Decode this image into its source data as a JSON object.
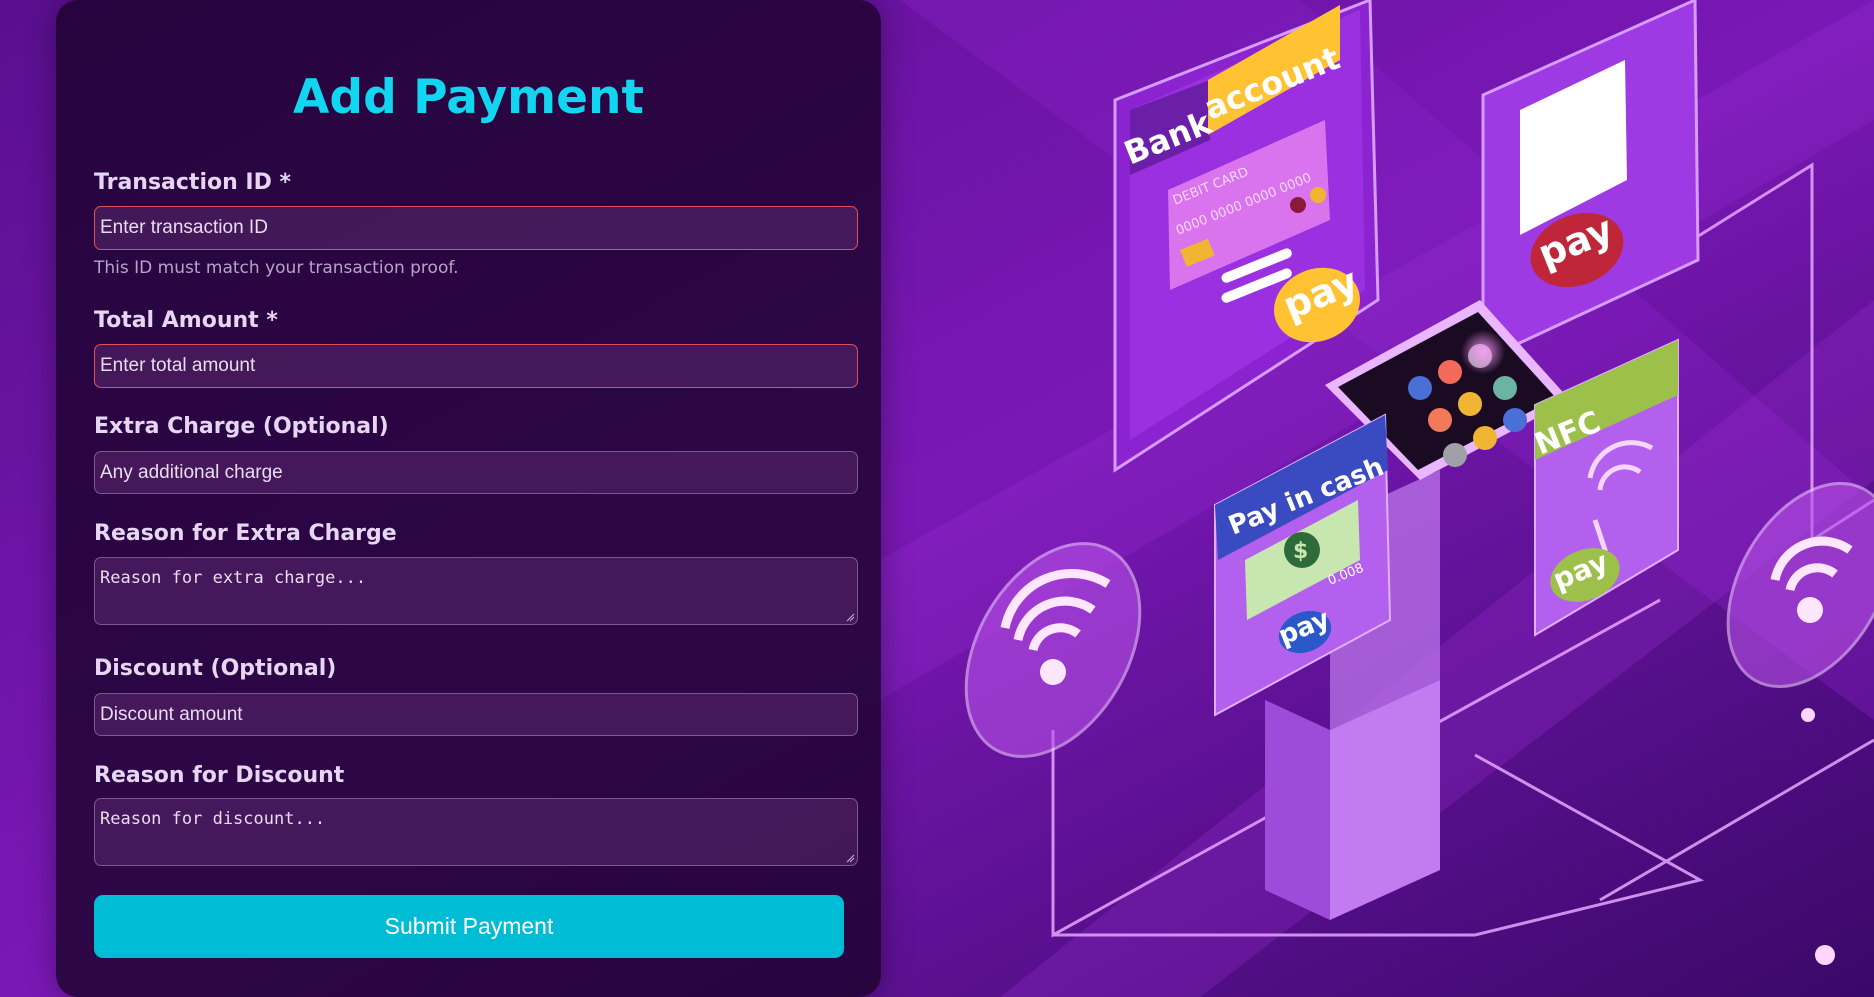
{
  "form": {
    "title": "Add Payment",
    "transaction_id": {
      "label": "Transaction ID *",
      "placeholder": "Enter transaction ID",
      "hint": "This ID must match your transaction proof."
    },
    "total_amount": {
      "label": "Total Amount *",
      "placeholder": "Enter total amount"
    },
    "extra_charge": {
      "label": "Extra Charge (Optional)",
      "placeholder": "Any additional charge"
    },
    "extra_reason": {
      "label": "Reason for Extra Charge",
      "placeholder": "Reason for extra charge..."
    },
    "discount": {
      "label": "Discount (Optional)",
      "placeholder": "Discount amount"
    },
    "discount_reason": {
      "label": "Reason for Discount",
      "placeholder": "Reason for discount..."
    },
    "submit_label": "Submit Payment"
  },
  "illustration": {
    "bank_word": "Bank",
    "account_word": "account",
    "debit_card": "DEBIT CARD",
    "card_digits": "0000 0000 0000 0000",
    "pay_word": "pay",
    "cash_label": "Pay in cash",
    "nfc_label": "NFC",
    "cash_amount": "0.008"
  },
  "colors": {
    "accent": "#12d6f0",
    "button": "#00bcd4",
    "required_border": "#e0505a",
    "background": "#4a0c78"
  },
  "icons": [
    "qr-code-icon",
    "wifi-icon",
    "dollar-bill-icon",
    "credit-card-icon",
    "nfc-hand-icon"
  ]
}
